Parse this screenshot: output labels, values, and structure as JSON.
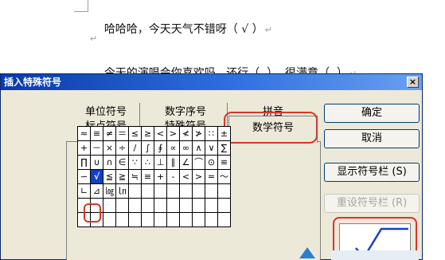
{
  "document": {
    "line1": "哈哈哈，今天天气不错呀（ √ ）",
    "line2": "今天的演唱会你喜欢吗   还行（  ）  很满意（  ）",
    "return_mark": "↵"
  },
  "dialog": {
    "title": "插入特殊符号",
    "close_label": "×",
    "tabs": {
      "units": "单位符号",
      "numbers": "数字序号",
      "pinyin": "拼音",
      "punctuation": "标点符号",
      "special": "特殊符号",
      "math": "数学符号"
    },
    "symbols": [
      [
        "≈",
        "≡",
        "≠",
        "＝",
        "≤",
        "≥",
        "<",
        ">",
        "≮",
        "≯",
        "∷",
        "±"
      ],
      [
        "+",
        "－",
        "×",
        "÷",
        "/",
        "∫",
        "∮",
        "∝",
        "∞",
        "∧",
        "∨",
        "∑"
      ],
      [
        "∏",
        "∪",
        "∩",
        "∈",
        "∵",
        "∴",
        "⊥",
        "∥",
        "∠",
        "⌒",
        "⊙",
        "≌"
      ],
      [
        "∽",
        "√",
        "≦",
        "≧",
        "≒",
        "≡",
        "+",
        "-",
        "<",
        ">",
        "=",
        "～"
      ],
      [
        "∟",
        "⊿",
        "㏒",
        "㏑",
        "",
        "",
        "",
        "",
        "",
        "",
        "",
        ""
      ],
      [
        "",
        "",
        "",
        "",
        "",
        "",
        "",
        "",
        "",
        "",
        "",
        ""
      ],
      [
        "",
        "",
        "",
        "",
        "",
        "",
        "",
        "",
        "",
        "",
        "",
        ""
      ]
    ],
    "selected_symbol": "√",
    "buttons": {
      "ok": "确定",
      "cancel": "取消",
      "show_bar": "显示符号栏 (S)",
      "reset_bar": "重设符号栏 (R)"
    }
  }
}
